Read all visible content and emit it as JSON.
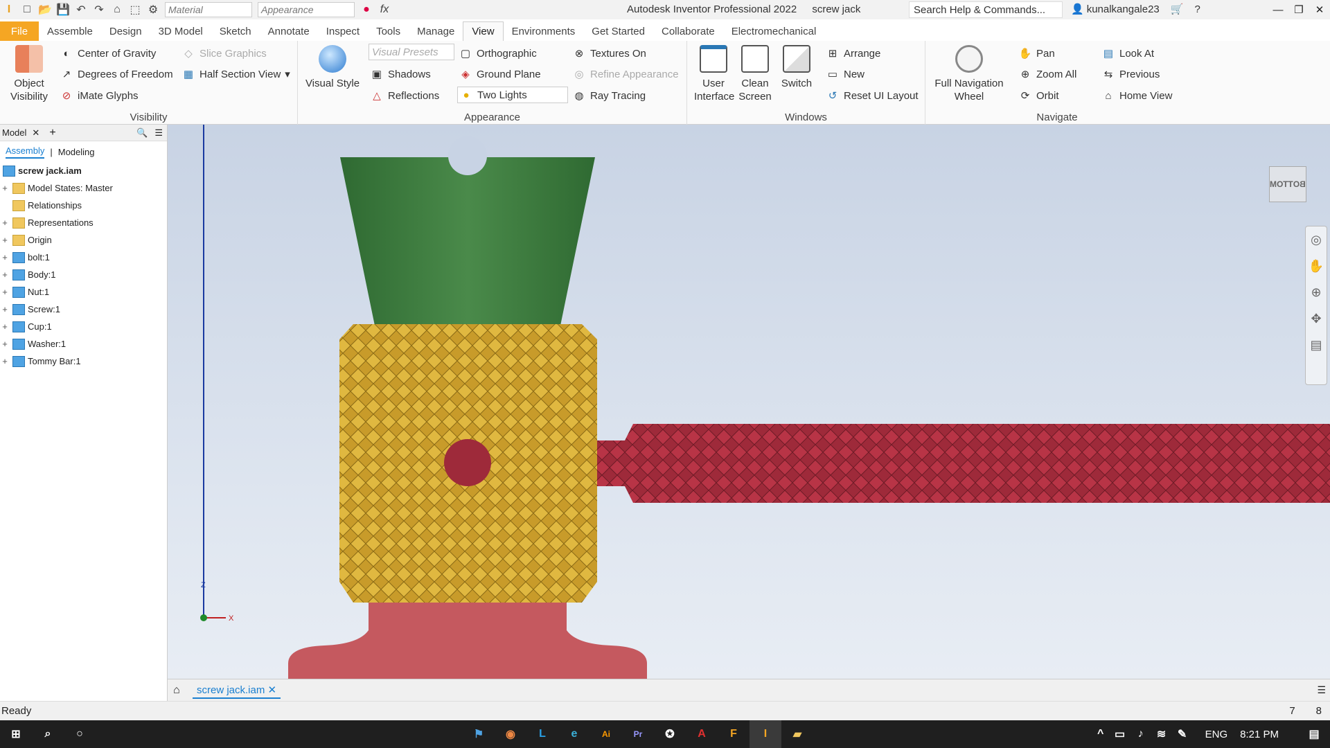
{
  "qat": {
    "material": "Material",
    "appearance": "Appearance"
  },
  "title": {
    "app": "Autodesk Inventor Professional 2022",
    "doc": "screw jack"
  },
  "search": {
    "placeholder": "Search Help & Commands..."
  },
  "user": {
    "name": "kunalkangale23"
  },
  "tabs": [
    "File",
    "Assemble",
    "Design",
    "3D Model",
    "Sketch",
    "Annotate",
    "Inspect",
    "Tools",
    "Manage",
    "View",
    "Environments",
    "Get Started",
    "Collaborate",
    "Electromechanical"
  ],
  "active_tab": "View",
  "visibility": {
    "title": "Visibility",
    "object_visibility": "Object Visibility",
    "center_of_gravity": "Center of Gravity",
    "degrees_of_freedom": "Degrees of Freedom",
    "imate_glyphs": "iMate Glyphs",
    "slice_graphics": "Slice Graphics",
    "half_section_view": "Half Section View"
  },
  "appearance": {
    "title": "Appearance",
    "visual_style": "Visual Style",
    "visual_presets": "Visual Presets",
    "shadows": "Shadows",
    "reflections": "Reflections",
    "orthographic": "Orthographic",
    "ground_plane": "Ground Plane",
    "two_lights": "Two Lights",
    "textures_on": "Textures On",
    "refine_appearance": "Refine Appearance",
    "ray_tracing": "Ray Tracing"
  },
  "windows": {
    "title": "Windows",
    "user_interface": "User Interface",
    "clean_screen": "Clean Screen",
    "switch": "Switch",
    "arrange": "Arrange",
    "new": "New",
    "reset_ui_layout": "Reset UI Layout"
  },
  "navigate": {
    "title": "Navigate",
    "full_navigation_wheel": "Full Navigation Wheel",
    "pan": "Pan",
    "zoom_all": "Zoom All",
    "orbit": "Orbit",
    "look_at": "Look At",
    "previous": "Previous",
    "home_view": "Home View"
  },
  "browser": {
    "tab": "Model",
    "subtab_assembly": "Assembly",
    "subtab_modeling": "Modeling",
    "root": "screw jack.iam",
    "items": [
      {
        "label": "Model States: Master",
        "icon": "folder",
        "expand": true
      },
      {
        "label": "Relationships",
        "icon": "folder",
        "expand": false
      },
      {
        "label": "Representations",
        "icon": "folder",
        "expand": true
      },
      {
        "label": "Origin",
        "icon": "folder",
        "expand": true
      },
      {
        "label": "bolt:1",
        "icon": "part",
        "expand": true
      },
      {
        "label": "Body:1",
        "icon": "part",
        "expand": true
      },
      {
        "label": "Nut:1",
        "icon": "part",
        "expand": true
      },
      {
        "label": "Screw:1",
        "icon": "part",
        "expand": true
      },
      {
        "label": "Cup:1",
        "icon": "part",
        "expand": true
      },
      {
        "label": "Washer:1",
        "icon": "part",
        "expand": true
      },
      {
        "label": "Tommy Bar:1",
        "icon": "part",
        "expand": true
      }
    ]
  },
  "viewcube": {
    "face": "BOTTOM"
  },
  "axes": {
    "z": "Z",
    "x": "X"
  },
  "doctab": {
    "label": "screw jack.iam"
  },
  "status": {
    "text": "Ready",
    "n1": "7",
    "n2": "8"
  },
  "taskbar": {
    "lang": "ENG",
    "time": "8:21 PM"
  },
  "colors": {
    "cup": "#3d7a3d",
    "nut": "#c89b2a",
    "bar": "#9e2a3a",
    "washer": "#c5595f"
  }
}
